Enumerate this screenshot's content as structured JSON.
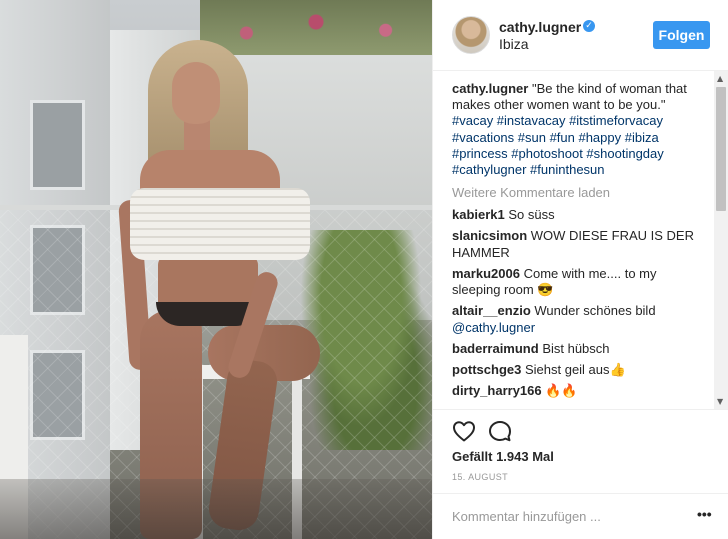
{
  "header": {
    "username": "cathy.lugner",
    "location": "Ibiza",
    "follow_label": "Folgen",
    "verified_glyph": "✓"
  },
  "caption": {
    "username": "cathy.lugner",
    "text": "\"Be the kind of woman that makes other women want to be you.\"",
    "hashtags": "#vacay #instavacay #itstimeforvacay #vacations #sun #fun #happy #ibiza #princess #photoshoot #shootingday #cathylugner #funinthesun"
  },
  "load_more": "Weitere Kommentare laden",
  "comments": [
    {
      "user": "kabierk1",
      "text": "So süss"
    },
    {
      "user": "slanicsimon",
      "text": "WOW DIESE FRAU IS DER HAMMER"
    },
    {
      "user": "marku2006",
      "text": "Come with me.... to my sleeping room 😎"
    },
    {
      "user": "altair__enzio",
      "text": "Wunder schönes bild",
      "mention": "@cathy.lugner"
    },
    {
      "user": "baderraimund",
      "text": "Bist hübsch"
    },
    {
      "user": "pottschge3",
      "text": "Siehst geil aus👍"
    },
    {
      "user": "dirty_harry166",
      "text": "🔥🔥"
    }
  ],
  "likes": "Gefällt 1.943 Mal",
  "date": "15. AUGUST",
  "comment_input": {
    "placeholder": "Kommentar hinzufügen ..."
  },
  "more_options_label": "•••",
  "icons": {
    "like": "heart-icon",
    "comment": "comment-icon",
    "verified": "verified-badge-icon",
    "more": "more-options-icon"
  },
  "colors": {
    "accent": "#3897f0",
    "link": "#003569",
    "muted": "#999999",
    "text": "#262626"
  }
}
